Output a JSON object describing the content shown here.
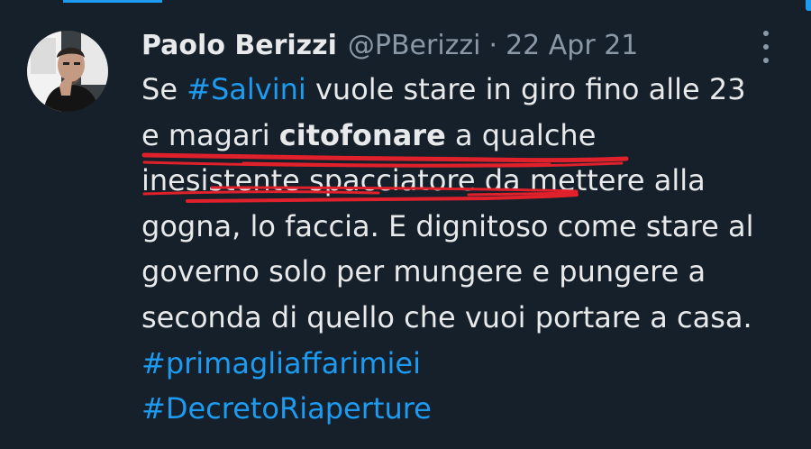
{
  "tweet": {
    "author_name": "Paolo Berizzi",
    "handle": "@PBerizzi",
    "separator": "·",
    "date": "22 Apr 21",
    "lines": {
      "l1_a": "Se ",
      "l1_tag": "#Salvini",
      "l1_b": " vuole stare in giro fino alle 23",
      "l2_a": "e magari ",
      "l2_bold": "citofonare",
      "l2_b": " a qualche",
      "l3": "inesistente spacciatore da mettere alla",
      "l4": "gogna, lo faccia. E dignitoso come stare al",
      "l5": "governo solo per mungere e pungere a",
      "l6": "seconda di quello che vuoi portare a casa.",
      "tag1": "#primagliaffarimiei",
      "tag2": "#DecretoRiaperture"
    }
  },
  "icons": {
    "avatar": "avatar-photo",
    "more": "more-options-icon"
  },
  "colors": {
    "background": "#15202b",
    "text": "#e7e9ea",
    "muted": "#8b98a5",
    "hashtag": "#1d9bf0",
    "annotation": "#e0202a"
  }
}
